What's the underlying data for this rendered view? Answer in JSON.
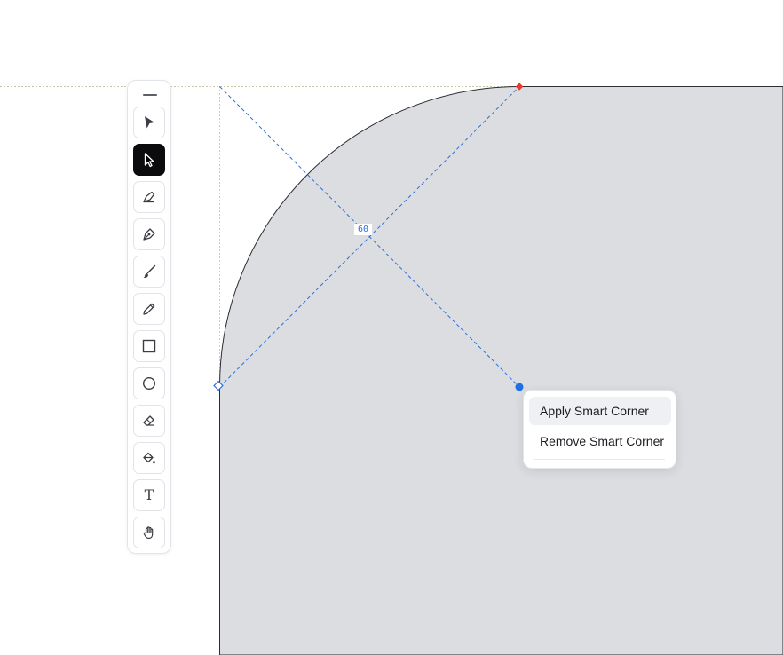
{
  "canvas": {
    "shape_fill": "#dcdde1",
    "shape_stroke": "#2b2d33",
    "guide_color": "#2a6fe0",
    "corner_handle_color": "#e53935",
    "radius_value": "60"
  },
  "toolbar": {
    "tools": [
      {
        "name": "direct-select",
        "icon": "arrow-solid-icon",
        "active": false
      },
      {
        "name": "select",
        "icon": "cursor-icon",
        "active": true
      },
      {
        "name": "vector-brush",
        "icon": "nib-icon",
        "active": false
      },
      {
        "name": "pen",
        "icon": "pen-tool-icon",
        "active": false
      },
      {
        "name": "brush",
        "icon": "brush-icon",
        "active": false
      },
      {
        "name": "pencil",
        "icon": "pencil-icon",
        "active": false
      },
      {
        "name": "rectangle",
        "icon": "square-icon",
        "active": false
      },
      {
        "name": "ellipse",
        "icon": "circle-icon",
        "active": false
      },
      {
        "name": "eraser",
        "icon": "eraser-icon",
        "active": false
      },
      {
        "name": "fill",
        "icon": "paint-bucket-icon",
        "active": false
      },
      {
        "name": "text",
        "icon": "text-icon",
        "label": "T",
        "active": false
      },
      {
        "name": "hand",
        "icon": "hand-icon",
        "active": false
      }
    ]
  },
  "context_menu": {
    "items": [
      {
        "label": "Apply Smart Corner"
      },
      {
        "label": "Remove Smart Corner"
      }
    ]
  }
}
